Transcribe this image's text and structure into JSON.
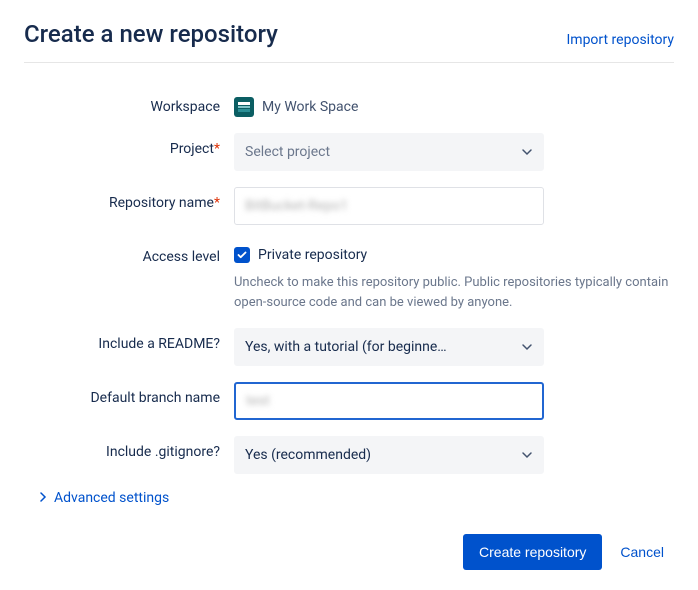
{
  "header": {
    "title": "Create a new repository",
    "import_link": "Import repository"
  },
  "labels": {
    "workspace": "Workspace",
    "project": "Project",
    "repo_name": "Repository name",
    "access_level": "Access level",
    "include_readme": "Include a README?",
    "default_branch": "Default branch name",
    "include_gitignore": "Include .gitignore?"
  },
  "values": {
    "workspace_name": "My Work Space",
    "project_placeholder": "Select project",
    "repo_name_value": "BitBucket-Repo1",
    "private_label": "Private repository",
    "access_help": "Uncheck to make this repository public. Public repositories typically contain open-source code and can be viewed by anyone.",
    "readme_selected": "Yes, with a tutorial (for beginne…",
    "branch_value": "test",
    "gitignore_selected": "Yes (recommended)"
  },
  "advanced_label": "Advanced settings",
  "buttons": {
    "create": "Create repository",
    "cancel": "Cancel"
  }
}
